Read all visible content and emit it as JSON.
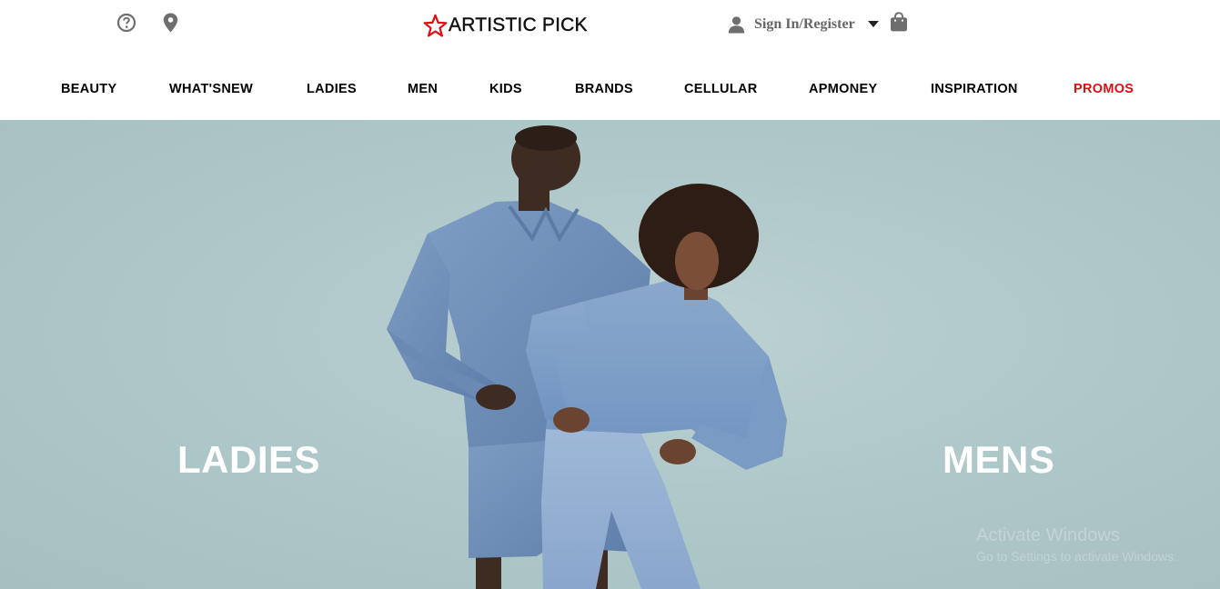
{
  "header": {
    "logo_text": "ARTISTIC PICK",
    "brand_color": "#e30b13",
    "account_label": "Sign In/Register",
    "icons": {
      "help": "help-circle-icon",
      "location": "map-pin-icon",
      "user": "user-icon",
      "cart": "shopping-bag-icon",
      "dropdown": "caret-down-icon"
    }
  },
  "nav": {
    "items": [
      {
        "label": "BEAUTY"
      },
      {
        "label": "WHAT'SNEW"
      },
      {
        "label": "LADIES"
      },
      {
        "label": "MEN"
      },
      {
        "label": "KIDS"
      },
      {
        "label": "BRANDS"
      },
      {
        "label": "CELLULAR"
      },
      {
        "label": "APMONEY"
      },
      {
        "label": "INSPIRATION"
      },
      {
        "label": "PROMOS",
        "color": "#e30b13"
      }
    ]
  },
  "hero": {
    "left_label": "LADIES",
    "right_label": "MENS",
    "background_color": "#afc8c9",
    "denim_color": "#6f8fb8"
  },
  "watermark": {
    "title": "Activate Windows",
    "subtitle": "Go to Settings to activate Windows."
  }
}
